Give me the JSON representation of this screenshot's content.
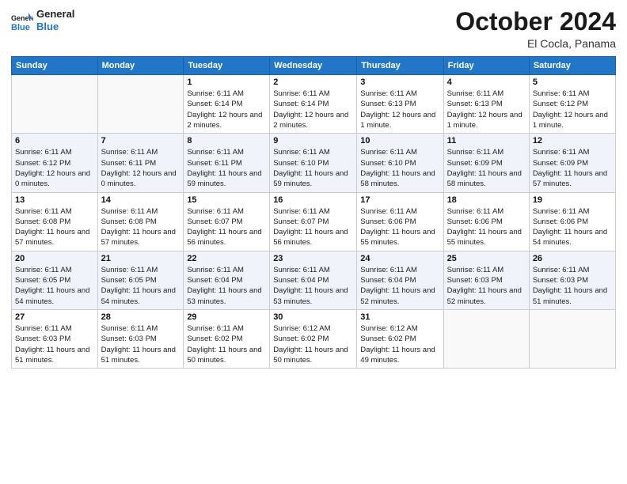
{
  "logo": {
    "line1": "General",
    "line2": "Blue"
  },
  "header": {
    "month": "October 2024",
    "location": "El Cocla, Panama"
  },
  "weekdays": [
    "Sunday",
    "Monday",
    "Tuesday",
    "Wednesday",
    "Thursday",
    "Friday",
    "Saturday"
  ],
  "weeks": [
    [
      {
        "day": "",
        "sunrise": "",
        "sunset": "",
        "daylight": ""
      },
      {
        "day": "",
        "sunrise": "",
        "sunset": "",
        "daylight": ""
      },
      {
        "day": "1",
        "sunrise": "Sunrise: 6:11 AM",
        "sunset": "Sunset: 6:14 PM",
        "daylight": "Daylight: 12 hours and 2 minutes."
      },
      {
        "day": "2",
        "sunrise": "Sunrise: 6:11 AM",
        "sunset": "Sunset: 6:14 PM",
        "daylight": "Daylight: 12 hours and 2 minutes."
      },
      {
        "day": "3",
        "sunrise": "Sunrise: 6:11 AM",
        "sunset": "Sunset: 6:13 PM",
        "daylight": "Daylight: 12 hours and 1 minute."
      },
      {
        "day": "4",
        "sunrise": "Sunrise: 6:11 AM",
        "sunset": "Sunset: 6:13 PM",
        "daylight": "Daylight: 12 hours and 1 minute."
      },
      {
        "day": "5",
        "sunrise": "Sunrise: 6:11 AM",
        "sunset": "Sunset: 6:12 PM",
        "daylight": "Daylight: 12 hours and 1 minute."
      }
    ],
    [
      {
        "day": "6",
        "sunrise": "Sunrise: 6:11 AM",
        "sunset": "Sunset: 6:12 PM",
        "daylight": "Daylight: 12 hours and 0 minutes."
      },
      {
        "day": "7",
        "sunrise": "Sunrise: 6:11 AM",
        "sunset": "Sunset: 6:11 PM",
        "daylight": "Daylight: 12 hours and 0 minutes."
      },
      {
        "day": "8",
        "sunrise": "Sunrise: 6:11 AM",
        "sunset": "Sunset: 6:11 PM",
        "daylight": "Daylight: 11 hours and 59 minutes."
      },
      {
        "day": "9",
        "sunrise": "Sunrise: 6:11 AM",
        "sunset": "Sunset: 6:10 PM",
        "daylight": "Daylight: 11 hours and 59 minutes."
      },
      {
        "day": "10",
        "sunrise": "Sunrise: 6:11 AM",
        "sunset": "Sunset: 6:10 PM",
        "daylight": "Daylight: 11 hours and 58 minutes."
      },
      {
        "day": "11",
        "sunrise": "Sunrise: 6:11 AM",
        "sunset": "Sunset: 6:09 PM",
        "daylight": "Daylight: 11 hours and 58 minutes."
      },
      {
        "day": "12",
        "sunrise": "Sunrise: 6:11 AM",
        "sunset": "Sunset: 6:09 PM",
        "daylight": "Daylight: 11 hours and 57 minutes."
      }
    ],
    [
      {
        "day": "13",
        "sunrise": "Sunrise: 6:11 AM",
        "sunset": "Sunset: 6:08 PM",
        "daylight": "Daylight: 11 hours and 57 minutes."
      },
      {
        "day": "14",
        "sunrise": "Sunrise: 6:11 AM",
        "sunset": "Sunset: 6:08 PM",
        "daylight": "Daylight: 11 hours and 57 minutes."
      },
      {
        "day": "15",
        "sunrise": "Sunrise: 6:11 AM",
        "sunset": "Sunset: 6:07 PM",
        "daylight": "Daylight: 11 hours and 56 minutes."
      },
      {
        "day": "16",
        "sunrise": "Sunrise: 6:11 AM",
        "sunset": "Sunset: 6:07 PM",
        "daylight": "Daylight: 11 hours and 56 minutes."
      },
      {
        "day": "17",
        "sunrise": "Sunrise: 6:11 AM",
        "sunset": "Sunset: 6:06 PM",
        "daylight": "Daylight: 11 hours and 55 minutes."
      },
      {
        "day": "18",
        "sunrise": "Sunrise: 6:11 AM",
        "sunset": "Sunset: 6:06 PM",
        "daylight": "Daylight: 11 hours and 55 minutes."
      },
      {
        "day": "19",
        "sunrise": "Sunrise: 6:11 AM",
        "sunset": "Sunset: 6:06 PM",
        "daylight": "Daylight: 11 hours and 54 minutes."
      }
    ],
    [
      {
        "day": "20",
        "sunrise": "Sunrise: 6:11 AM",
        "sunset": "Sunset: 6:05 PM",
        "daylight": "Daylight: 11 hours and 54 minutes."
      },
      {
        "day": "21",
        "sunrise": "Sunrise: 6:11 AM",
        "sunset": "Sunset: 6:05 PM",
        "daylight": "Daylight: 11 hours and 54 minutes."
      },
      {
        "day": "22",
        "sunrise": "Sunrise: 6:11 AM",
        "sunset": "Sunset: 6:04 PM",
        "daylight": "Daylight: 11 hours and 53 minutes."
      },
      {
        "day": "23",
        "sunrise": "Sunrise: 6:11 AM",
        "sunset": "Sunset: 6:04 PM",
        "daylight": "Daylight: 11 hours and 53 minutes."
      },
      {
        "day": "24",
        "sunrise": "Sunrise: 6:11 AM",
        "sunset": "Sunset: 6:04 PM",
        "daylight": "Daylight: 11 hours and 52 minutes."
      },
      {
        "day": "25",
        "sunrise": "Sunrise: 6:11 AM",
        "sunset": "Sunset: 6:03 PM",
        "daylight": "Daylight: 11 hours and 52 minutes."
      },
      {
        "day": "26",
        "sunrise": "Sunrise: 6:11 AM",
        "sunset": "Sunset: 6:03 PM",
        "daylight": "Daylight: 11 hours and 51 minutes."
      }
    ],
    [
      {
        "day": "27",
        "sunrise": "Sunrise: 6:11 AM",
        "sunset": "Sunset: 6:03 PM",
        "daylight": "Daylight: 11 hours and 51 minutes."
      },
      {
        "day": "28",
        "sunrise": "Sunrise: 6:11 AM",
        "sunset": "Sunset: 6:03 PM",
        "daylight": "Daylight: 11 hours and 51 minutes."
      },
      {
        "day": "29",
        "sunrise": "Sunrise: 6:11 AM",
        "sunset": "Sunset: 6:02 PM",
        "daylight": "Daylight: 11 hours and 50 minutes."
      },
      {
        "day": "30",
        "sunrise": "Sunrise: 6:12 AM",
        "sunset": "Sunset: 6:02 PM",
        "daylight": "Daylight: 11 hours and 50 minutes."
      },
      {
        "day": "31",
        "sunrise": "Sunrise: 6:12 AM",
        "sunset": "Sunset: 6:02 PM",
        "daylight": "Daylight: 11 hours and 49 minutes."
      },
      {
        "day": "",
        "sunrise": "",
        "sunset": "",
        "daylight": ""
      },
      {
        "day": "",
        "sunrise": "",
        "sunset": "",
        "daylight": ""
      }
    ]
  ]
}
